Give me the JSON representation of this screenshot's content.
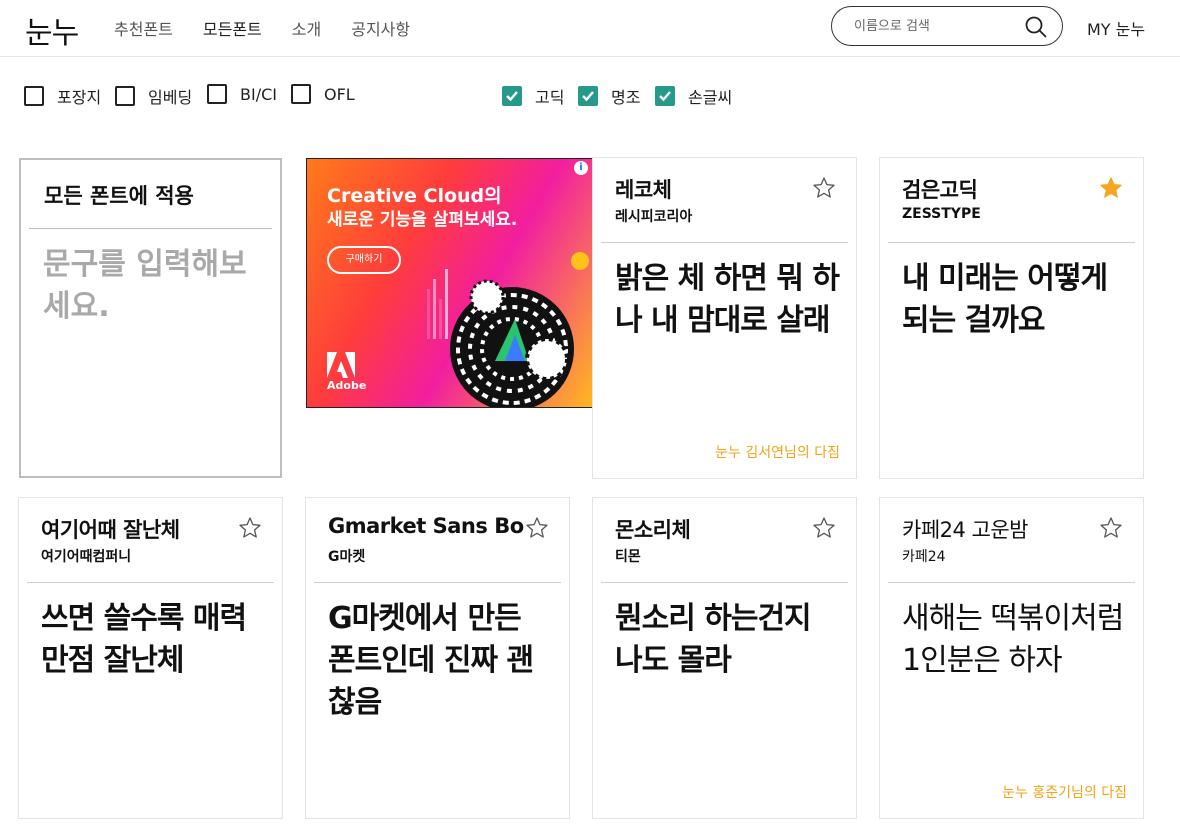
{
  "header": {
    "logo": "눈누",
    "nav": [
      "추천폰트",
      "모든폰트",
      "소개",
      "공지사항"
    ],
    "active_nav": "모든폰트",
    "search_placeholder": "이름으로 검색",
    "my_label": "MY 눈누"
  },
  "filters": {
    "license": [
      {
        "label": "포장지",
        "checked": false
      },
      {
        "label": "임베딩",
        "checked": false
      },
      {
        "label": "BI/CI",
        "checked": false
      },
      {
        "label": "OFL",
        "checked": false
      }
    ],
    "style": [
      {
        "label": "고딕",
        "checked": true
      },
      {
        "label": "명조",
        "checked": true
      },
      {
        "label": "손글씨",
        "checked": true
      }
    ]
  },
  "apply_card": {
    "title": "모든 폰트에 적용",
    "placeholder": "문구를 입력해보세요."
  },
  "ad": {
    "headline1": "Creative Cloud의",
    "headline2": "새로운 기능을 살펴보세요.",
    "button": "구매하기",
    "brand": "Adobe"
  },
  "fonts": [
    {
      "name": "레코체",
      "maker": "레시피코리아",
      "sample": "밝은 체 하면 뭐 하나 내 맘대로 살래",
      "favorited": false,
      "pledge": "눈누 김서연님의 다짐"
    },
    {
      "name": "검은고딕",
      "maker": "ZESSTYPE",
      "sample": "내 미래는 어떻게 되는 걸까요",
      "favorited": true,
      "pledge": ""
    },
    {
      "name": "여기어때 잘난체",
      "maker": "여기어때컴퍼니",
      "sample": "쓰면 쓸수록 매력만점 잘난체",
      "favorited": false,
      "pledge": ""
    },
    {
      "name": "Gmarket Sans Bold",
      "maker": "G마켓",
      "sample": "G마켓에서 만든 폰트인데 진짜 괜찮음",
      "favorited": false,
      "pledge": ""
    },
    {
      "name": "몬소리체",
      "maker": "티몬",
      "sample": "뭔소리 하는건지 나도 몰라",
      "favorited": false,
      "pledge": ""
    },
    {
      "name": "카페24 고운밤",
      "maker": "카페24",
      "sample": "새해는 떡볶이처럼 1인분은 하자",
      "favorited": false,
      "pledge": "눈누 홍준기님의 다짐"
    }
  ],
  "colors": {
    "checkbox_checked": "#26998a",
    "star_active": "#f5a623",
    "pledge": "#f2a316"
  }
}
